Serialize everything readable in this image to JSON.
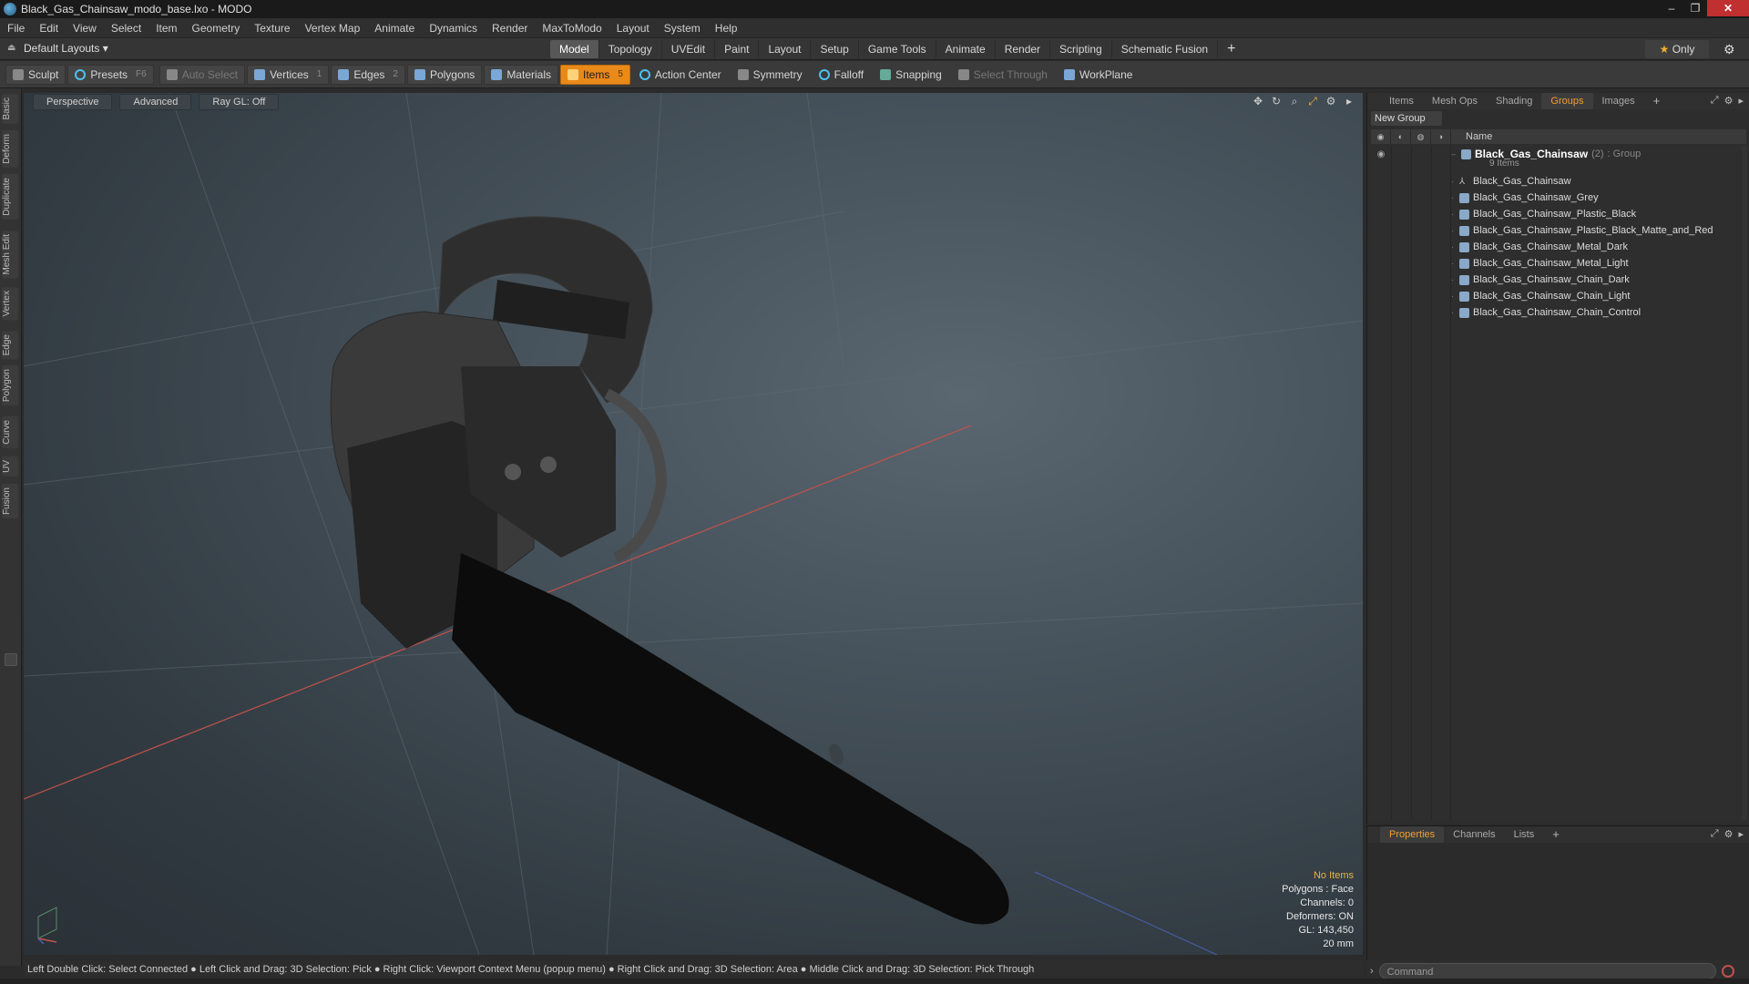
{
  "window": {
    "title": "Black_Gas_Chainsaw_modo_base.lxo - MODO",
    "min": "–",
    "max": "❐",
    "close": "✕"
  },
  "menu": [
    "File",
    "Edit",
    "View",
    "Select",
    "Item",
    "Geometry",
    "Texture",
    "Vertex Map",
    "Animate",
    "Dynamics",
    "Render",
    "MaxToModo",
    "Layout",
    "System",
    "Help"
  ],
  "layouts": {
    "label": "Default Layouts ▾"
  },
  "modetabs": [
    "Model",
    "Topology",
    "UVEdit",
    "Paint",
    "Layout",
    "Setup",
    "Game Tools",
    "Animate",
    "Render",
    "Scripting",
    "Schematic Fusion"
  ],
  "modetabs_active": "Model",
  "only_label": "Only",
  "toolbar": {
    "sculpt": "Sculpt",
    "presets": "Presets",
    "presets_key": "F6",
    "auto_select": "Auto Select",
    "vertices": "Vertices",
    "vertices_key": "1",
    "edges": "Edges",
    "edges_key": "2",
    "polygons": "Polygons",
    "materials": "Materials",
    "items": "Items",
    "items_key": "5",
    "action_center": "Action Center",
    "symmetry": "Symmetry",
    "falloff": "Falloff",
    "snapping": "Snapping",
    "select_through": "Select Through",
    "workplane": "WorkPlane"
  },
  "lefttabs": [
    "Basic",
    "Deform",
    "Duplicate",
    "Mesh Edit",
    "Vertex",
    "Edge",
    "Polygon",
    "Curve",
    "UV",
    "Fusion"
  ],
  "viewport": {
    "view": "Perspective",
    "mode": "Advanced",
    "raygl": "Ray GL: Off",
    "stats": {
      "items": "No Items",
      "polygons": "Polygons : Face",
      "channels": "Channels: 0",
      "deformers": "Deformers: ON",
      "gl": "GL: 143,450",
      "scale": "20 mm"
    }
  },
  "statusbar": "Left Double Click: Select Connected ● Left Click and Drag: 3D Selection: Pick ● Right Click: Viewport Context Menu (popup menu) ● Right Click and Drag: 3D Selection: Area ● Middle Click and Drag: 3D Selection: Pick Through",
  "rightpanel": {
    "tabs": [
      "Items",
      "Mesh Ops",
      "Shading",
      "Groups",
      "Images"
    ],
    "active": "Groups",
    "new_group": "New Group",
    "name_header": "Name",
    "group": {
      "name": "Black_Gas_Chainsaw",
      "count": "(2)",
      "type": ": Group",
      "sub": "9 Items"
    },
    "items": [
      "Black_Gas_Chainsaw",
      "Black_Gas_Chainsaw_Grey",
      "Black_Gas_Chainsaw_Plastic_Black",
      "Black_Gas_Chainsaw_Plastic_Black_Matte_and_Red",
      "Black_Gas_Chainsaw_Metal_Dark",
      "Black_Gas_Chainsaw_Metal_Light",
      "Black_Gas_Chainsaw_Chain_Dark",
      "Black_Gas_Chainsaw_Chain_Light",
      "Black_Gas_Chainsaw_Chain_Control"
    ]
  },
  "properties": {
    "tabs": [
      "Properties",
      "Channels",
      "Lists"
    ],
    "active": "Properties"
  },
  "command": {
    "placeholder": "Command"
  },
  "colors": {
    "accent": "#f0a030",
    "active_tool": "#e88a1a",
    "close": "#c03030"
  }
}
